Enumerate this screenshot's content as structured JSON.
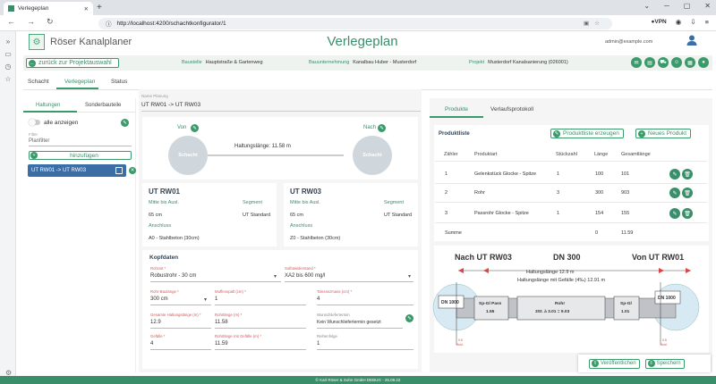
{
  "browser": {
    "tab_title": "Verlegeplan",
    "url": "http://localhost:4200/schachtkonfigurator/1",
    "vpn_label": "VPN"
  },
  "header": {
    "app_title": "Röser Kanalplaner",
    "page_title": "Verlegeplan",
    "user_email": "admin@example.com"
  },
  "infobar": {
    "back_label": "zurück zur Projektauswahl",
    "baustelle_label": "Baustelle",
    "baustelle_value": "Hauptstraße & Gartenweg",
    "bauunternehmung_label": "Bauunternehmung",
    "bauunternehmung_value": "Kanalbau Huber - Musterdorf",
    "projekt_label": "Projekt",
    "projekt_value": "Musterdorf Kanalsanierung (026001)"
  },
  "tabs": [
    "Schacht",
    "Verlegeplan",
    "Status"
  ],
  "left": {
    "subtabs": [
      "Haltungen",
      "Sonderbauteile"
    ],
    "show_all_label": "alle anzeigen",
    "filter_label": "Filter",
    "filter_placeholder": "Planfilter",
    "add_label": "hinzufügen",
    "haltung_item": "UT RW01 -> UT RW03"
  },
  "planung": {
    "name_label": "Name Planung",
    "name_value": "UT RW01 -> UT RW03",
    "von_label": "Von",
    "nach_label": "Nach",
    "schacht_label": "Schacht",
    "haltungslaenge": "Haltungslänge: 11.58 m"
  },
  "cards": [
    {
      "title": "UT RW01",
      "mitte_label": "Mitte bis Ausl.",
      "segment_label": "Segment",
      "mitte_value": "65 cm",
      "segment_value": "UT Standard",
      "anschluss_label": "Anschluss",
      "anschluss_value": "A0 - Stahlbeton (30cm)"
    },
    {
      "title": "UT RW03",
      "mitte_label": "Mitte bis Ausl.",
      "segment_label": "Segment",
      "mitte_value": "65 cm",
      "segment_value": "UT Standard",
      "anschluss_label": "Anschluss",
      "anschluss_value": "Z0 - Stahlbeton (30cm)"
    }
  ],
  "kopfdaten": {
    "title": "Kopfdaten",
    "rohrart_label": "Rohrart *",
    "rohrart_value": "Robustrohr - 30 cm",
    "sulfat_label": "Sulfatwiderstand *",
    "sulfat_value": "XA2 bis 600 mg/l",
    "baulaenge_label": "Rohr-Baulänge *",
    "baulaenge_value": "300 cm",
    "muffenspalt_label": "Muffenspalt (cm) *",
    "muffenspalt_value": "1",
    "toleranz_label": "Toleranzmass (cm) *",
    "toleranz_value": "4",
    "gesamt_label": "Gesamte Haltungslänge (m) *",
    "gesamt_value": "12.9",
    "rohrlaenge_label": "Rohrlänge (m) *",
    "rohrlaenge_value": "11.58",
    "wunsch_label": "Wunschliefertermin",
    "wunsch_value": "Kein Wunschliefertermin gesetzt",
    "gefaelle_label": "Gefälle *",
    "gefaelle_value": "4",
    "rohrlaenge_gef_label": "Rohrlänge mit Gefälle (m) *",
    "rohrlaenge_gef_value": "11.59",
    "reihenfolge_label": "Reihenfolge",
    "reihenfolge_value": "1"
  },
  "right": {
    "tabs": [
      "Produkte",
      "Verlaufsprotokoll"
    ],
    "produktliste_title": "Produktliste",
    "erzeugen_label": "Produktliste erzeugen",
    "neues_label": "Neues Produkt",
    "columns": [
      "Zähler",
      "Produktart",
      "Stückzahl",
      "Länge",
      "Gesamtlänge"
    ],
    "rows": [
      {
        "z": "1",
        "art": "Gelenkstück Glocke - Spitze",
        "stk": "1",
        "len": "100",
        "ges": "101"
      },
      {
        "z": "2",
        "art": "Rohr",
        "stk": "3",
        "len": "300",
        "ges": "903"
      },
      {
        "z": "3",
        "art": "Passrohr Glocke - Spitze",
        "stk": "1",
        "len": "154",
        "ges": "155"
      }
    ],
    "summe_label": "Summe",
    "summe_len": "0",
    "summe_ges": "11.59"
  },
  "diagram": {
    "nach_label": "Nach UT RW03",
    "dn_label": "DN 300",
    "von_label": "Von UT RW01",
    "haltung_line1": "Haltungslänge 12.9 m",
    "haltung_line2": "Haltungslänge mit Gefälle (4‰) 12.91 m",
    "dn1000": "DN 1000",
    "seg1_a": "Sp-Gl Pass",
    "seg1_b": "1.55",
    "seg2_a": "Rohr",
    "seg2_b": "3St. à 3.01 = 9.03",
    "seg3_a": "Sp-Gl",
    "seg3_b": "1.01",
    "ausl_left": "0.5",
    "ausl_left_b": "Ausl.",
    "ausl_right": "0.5",
    "ausl_right_b": "Ausl."
  },
  "footer": {
    "veroeffentlichen": "Veröffentlichen",
    "speichern": "Speichern",
    "copyright": "© Karl Röser & Sohn GmbH",
    "version": "DEBUG - 26.09.22"
  },
  "colors": {
    "accent": "#3a8f6a",
    "selected": "#3a6ea5"
  }
}
